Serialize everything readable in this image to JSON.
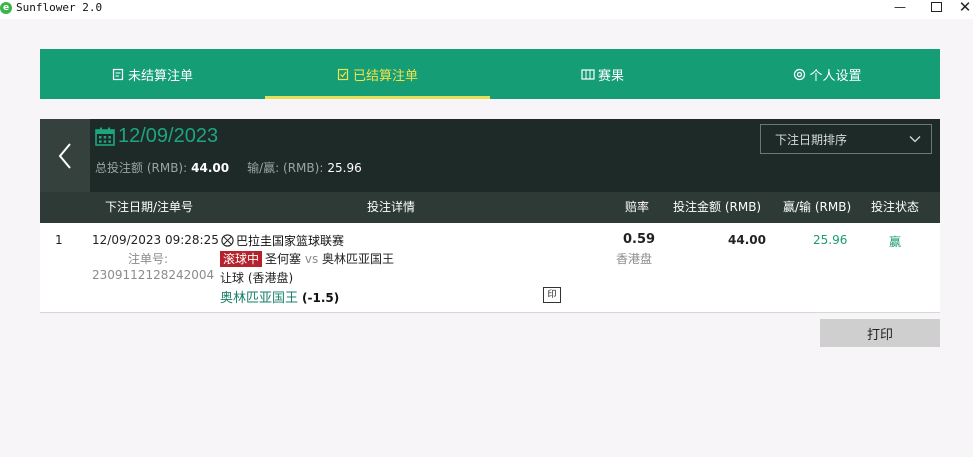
{
  "window": {
    "title": "Sunflower 2.0",
    "logo_letter": "e",
    "min_glyph": "—",
    "close_glyph": "✕"
  },
  "tabs": [
    {
      "label": "未结算注单",
      "icon": "unsettled-ticket-icon",
      "active": false
    },
    {
      "label": "已结算注单",
      "icon": "settled-ticket-icon",
      "active": true
    },
    {
      "label": "赛果",
      "icon": "results-icon",
      "active": false
    },
    {
      "label": "个人设置",
      "icon": "settings-icon",
      "active": false
    }
  ],
  "colors": {
    "tab_bar": "#159e76",
    "active_tab": "#f2e24d",
    "panel": "#1e2a27",
    "header_row": "#2d3a36",
    "accent_green": "#1da57e",
    "live_badge": "#b5222b"
  },
  "panel": {
    "date": "12/09/2023",
    "total_label": "总投注额 (RMB):",
    "total_value": "44.00",
    "winloss_label": "输/赢: (RMB):",
    "winloss_value": "25.96",
    "sort_value": "下注日期排序"
  },
  "table": {
    "headers": [
      "下注日期/注单号",
      "投注详情",
      "赔率",
      "投注金额 (RMB)",
      "赢/输 (RMB)",
      "投注状态"
    ],
    "rows": [
      {
        "index": "1",
        "datetime": "12/09/2023 09:28:25",
        "ticket_label": "注单号:",
        "ticket_no": "2309112128242004",
        "league": "巴拉圭国家篮球联赛",
        "live_badge": "滚球中",
        "home": "圣何塞",
        "vs": "vs",
        "away": "奥林匹亚国王",
        "bet_type": "让球 (香港盘)",
        "pick": "奥林匹亚国王",
        "pick_line": "(-1.5)",
        "print_tag": "印",
        "odds": "0.59",
        "odds_type": "香港盘",
        "stake": "44.00",
        "winloss": "25.96",
        "status": "赢"
      }
    ]
  },
  "print_button": "打印"
}
